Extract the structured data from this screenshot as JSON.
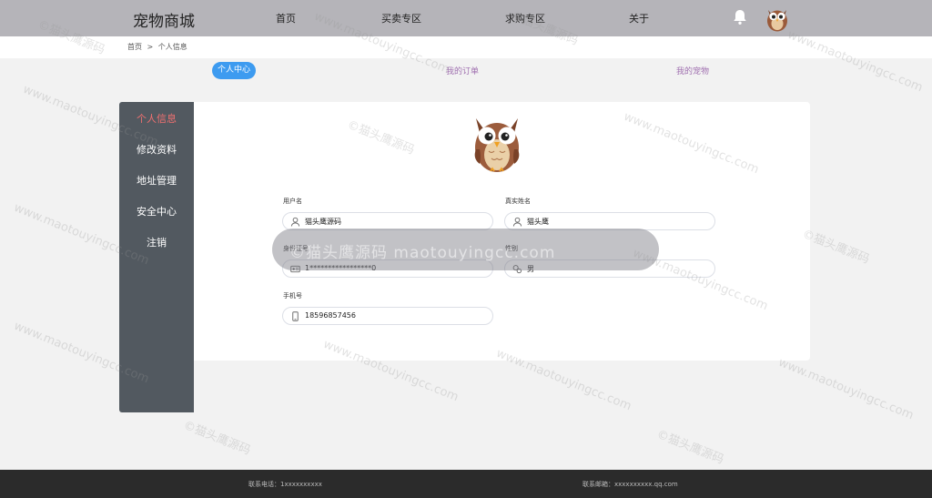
{
  "header": {
    "brand": "宠物商城",
    "nav": [
      "首页",
      "买卖专区",
      "求购专区",
      "关于"
    ]
  },
  "breadcrumb": {
    "home": "首页",
    "sep": ">",
    "current": "个人信息"
  },
  "tabs": [
    "个人中心",
    "我的订单",
    "我的宠物"
  ],
  "sidebar": {
    "items": [
      "个人信息",
      "修改资料",
      "地址管理",
      "安全中心",
      "注销"
    ]
  },
  "profile": {
    "username_label": "用户名",
    "username": "猫头鹰源码",
    "realname_label": "真实姓名",
    "realname": "猫头鹰",
    "idcard_label": "身份证号",
    "idcard": "1*****************0",
    "gender_label": "性别",
    "gender": "男",
    "phone_label": "手机号",
    "phone": "18596857456"
  },
  "watermark": {
    "center": "©猫头鹰源码 maotouyingcc.com",
    "text_cn": "©猫头鹰源码",
    "text_url": "www.maotouyingcc.com"
  },
  "footer": {
    "phone": "联系电话：1xxxxxxxxxx",
    "email": "联系邮箱：xxxxxxxxxx.qq.com"
  },
  "colors": {
    "topbar": "#b5b4b9",
    "sidebar": "#525960",
    "tab_active": "#3d9bf0",
    "sidebar_active": "#f07070",
    "footer": "#2b2b2b"
  }
}
